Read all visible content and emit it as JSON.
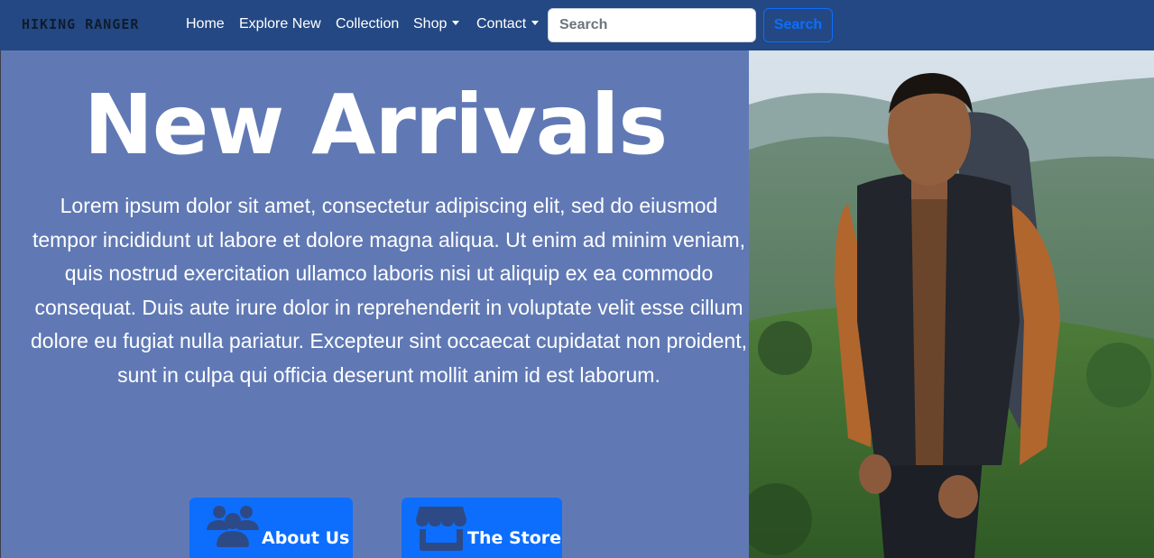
{
  "navbar": {
    "brand": "HIKING RANGER",
    "items": [
      {
        "label": "Home"
      },
      {
        "label": "Explore New"
      },
      {
        "label": "Collection"
      },
      {
        "label": "Shop"
      },
      {
        "label": "Contact"
      }
    ],
    "search": {
      "placeholder": "Search",
      "button_label": "Search"
    }
  },
  "hero": {
    "title": "New Arrivals",
    "body": "Lorem ipsum dolor sit amet, consectetur adipiscing elit, sed do eiusmod tempor incididunt ut labore et dolore magna aliqua. Ut enim ad minim veniam, quis nostrud exercitation ullamco laboris nisi ut aliquip ex ea commodo consequat. Duis aute irure dolor in reprehenderit in voluptate velit esse cillum dolore eu fugiat nulla pariatur. Excepteur sint occaecat cupidatat non proident, sunt in culpa qui officia deserunt mollit anim id est laborum.",
    "buttons": [
      {
        "label": "About Us",
        "icon": "users-icon"
      },
      {
        "label": "The Store",
        "icon": "store-icon"
      }
    ]
  },
  "colors": {
    "navbar_bg": "#244883",
    "hero_bg": "#6079b5",
    "primary": "#0d6efd"
  }
}
